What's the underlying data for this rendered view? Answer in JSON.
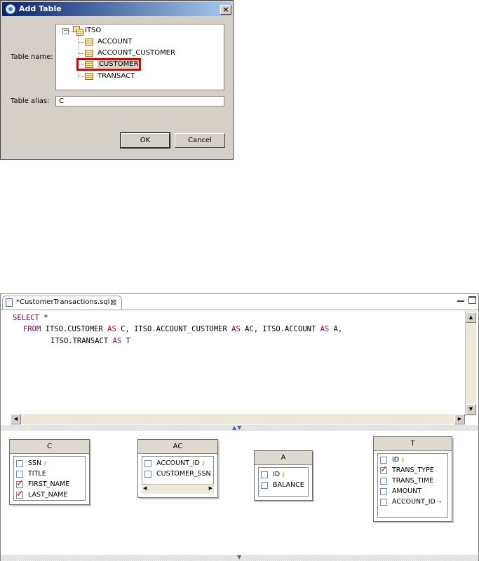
{
  "dialog": {
    "title": "Add Table",
    "close_label": "×",
    "table_name_label": "Table name:",
    "tree": {
      "expander": "−",
      "root": "ITSO",
      "items": [
        "ACCOUNT",
        "ACCOUNT_CUSTOMER",
        "CUSTOMER",
        "TRANSACT"
      ],
      "selected": "CUSTOMER"
    },
    "table_alias_label": "Table alias:",
    "table_alias_value": "C",
    "ok_label": "OK",
    "cancel_label": "Cancel"
  },
  "editor": {
    "tab_title": "*CustomerTransactions.sql",
    "tab_close": "⊠",
    "sql": {
      "line1_kw": "SELECT",
      "line1_rest": " *",
      "line2_kw": "FROM",
      "line2_a": " ITSO.CUSTOMER ",
      "line2_as1": "AS",
      "line2_b": " C, ITSO.ACCOUNT_CUSTOMER ",
      "line2_as2": "AS",
      "line2_c": " AC, ITSO.ACCOUNT ",
      "line2_as3": "AS",
      "line2_d": " A,",
      "line3_a": "ITSO.TRANSACT ",
      "line3_as": "AS",
      "line3_b": " T"
    },
    "scroll_up": "▲",
    "scroll_down": "▼",
    "scroll_left": "◀",
    "scroll_right": "▶",
    "split_arrows": "▲▼",
    "bottom_arrow": "▼",
    "tables": {
      "c": {
        "name": "C",
        "columns": [
          {
            "name": "SSN",
            "checked": false,
            "icon": "key-icon"
          },
          {
            "name": "TITLE",
            "checked": false
          },
          {
            "name": "FIRST_NAME",
            "checked": true
          },
          {
            "name": "LAST_NAME",
            "checked": true
          }
        ]
      },
      "ac": {
        "name": "AC",
        "columns": [
          {
            "name": "ACCOUNT_ID",
            "checked": false,
            "icon": "key-icon"
          },
          {
            "name": "CUSTOMER_SSN",
            "checked": false,
            "icon": "key-icon"
          }
        ]
      },
      "a": {
        "name": "A",
        "columns": [
          {
            "name": "ID",
            "checked": false,
            "icon": "key-icon"
          },
          {
            "name": "BALANCE",
            "checked": false
          }
        ]
      },
      "t": {
        "name": "T",
        "columns": [
          {
            "name": "ID",
            "checked": false,
            "icon": "key-icon"
          },
          {
            "name": "TRANS_TYPE",
            "checked": true
          },
          {
            "name": "TRANS_TIME",
            "checked": false
          },
          {
            "name": "AMOUNT",
            "checked": false
          },
          {
            "name": "ACCOUNT_ID",
            "checked": false,
            "icon": "foreign-key-icon"
          }
        ]
      }
    }
  }
}
